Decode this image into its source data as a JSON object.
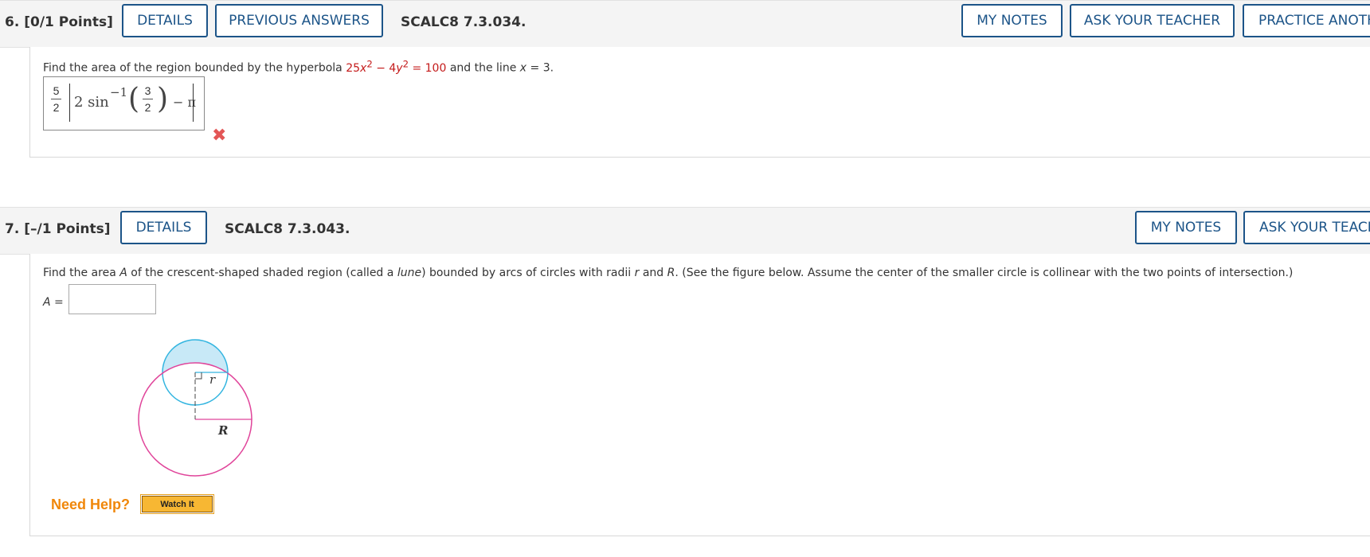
{
  "q6": {
    "number": "6.",
    "points": "[0/1 Points]",
    "details_label": "DETAILS",
    "previous_answers_label": "PREVIOUS ANSWERS",
    "code": "SCALC8 7.3.034.",
    "my_notes_label": "MY NOTES",
    "ask_teacher_label": "ASK YOUR TEACHER",
    "practice_label": "PRACTICE ANOTH",
    "prompt": {
      "before": "Find the area of the region bounded by the hyperbola ",
      "eq_a": "25",
      "eq_x": "x",
      "eq_exp1": "2",
      "eq_minus": " − 4",
      "eq_y": "y",
      "eq_exp2": "2",
      "eq_equals": " = 100",
      "middle": " and the line ",
      "line_x": "x",
      "line_eq": " = 3",
      "end": "."
    },
    "answer": {
      "coef_num": "5",
      "coef_den": "2",
      "two_sin": "2 sin",
      "inv": "−1",
      "arg_num": "3",
      "arg_den": "2",
      "minus_pi": "− π"
    },
    "result_icon": "incorrect-x-icon",
    "result_color": "#e35656"
  },
  "q7": {
    "number": "7.",
    "points": "[–/1 Points]",
    "details_label": "DETAILS",
    "code": "SCALC8 7.3.043.",
    "my_notes_label": "MY NOTES",
    "ask_teacher_label": "ASK YOUR TEACH",
    "prompt": {
      "p1": "Find the area ",
      "A": "A",
      "p2": " of the crescent-shaped shaded region (called a ",
      "lune": "lune",
      "p3": ") bounded by arcs of circles with radii ",
      "r": "r",
      "p4": " and ",
      "R": "R",
      "p5": ". (See the figure below. Assume the center of the smaller circle is collinear with the two points of intersection.)"
    },
    "answer_label": "A",
    "answer_eq": " =",
    "answer_value": "",
    "figure": {
      "label_r": "r",
      "label_R": "R",
      "small_circle_color": "#33b5e0",
      "large_circle_color": "#e0449a",
      "shade_color": "#c8e9f7"
    },
    "need_help": "Need Help?",
    "watch_it": "Watch It"
  },
  "colors": {
    "accent": "#1c5488",
    "header_bg": "#f4f4f4",
    "need_help": "#f0870a",
    "math_red": "#c41a1a"
  }
}
